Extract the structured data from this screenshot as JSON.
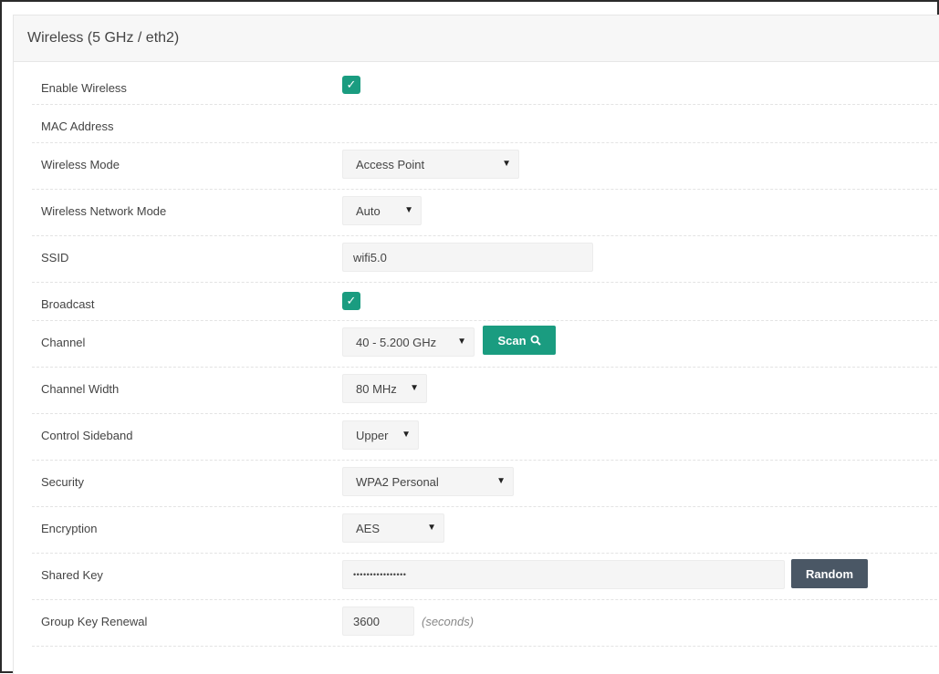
{
  "panel": {
    "title": "Wireless (5 GHz / eth2)"
  },
  "rows": {
    "enable_wireless": {
      "label": "Enable Wireless",
      "checked": true
    },
    "mac_address": {
      "label": "MAC Address",
      "value": ""
    },
    "wireless_mode": {
      "label": "Wireless Mode",
      "value": "Access Point"
    },
    "network_mode": {
      "label": "Wireless Network Mode",
      "value": "Auto"
    },
    "ssid": {
      "label": "SSID",
      "value": "wifi5.0"
    },
    "broadcast": {
      "label": "Broadcast",
      "checked": true
    },
    "channel": {
      "label": "Channel",
      "value": "40 - 5.200 GHz",
      "scan_label": "Scan"
    },
    "channel_width": {
      "label": "Channel Width",
      "value": "80 MHz"
    },
    "control_sideband": {
      "label": "Control Sideband",
      "value": "Upper"
    },
    "security": {
      "label": "Security",
      "value": "WPA2 Personal"
    },
    "encryption": {
      "label": "Encryption",
      "value": "AES"
    },
    "shared_key": {
      "label": "Shared Key",
      "value": "••••••••••••••••",
      "random_label": "Random"
    },
    "group_key_renewal": {
      "label": "Group Key Renewal",
      "value": "3600",
      "unit": "(seconds)"
    }
  },
  "icons": {
    "check": "checkmark-icon",
    "caret": "caret-down-icon",
    "search": "search-icon"
  },
  "colors": {
    "accent": "#1a9c80",
    "dark_button": "#4a5765",
    "field_bg": "#f5f5f5"
  }
}
